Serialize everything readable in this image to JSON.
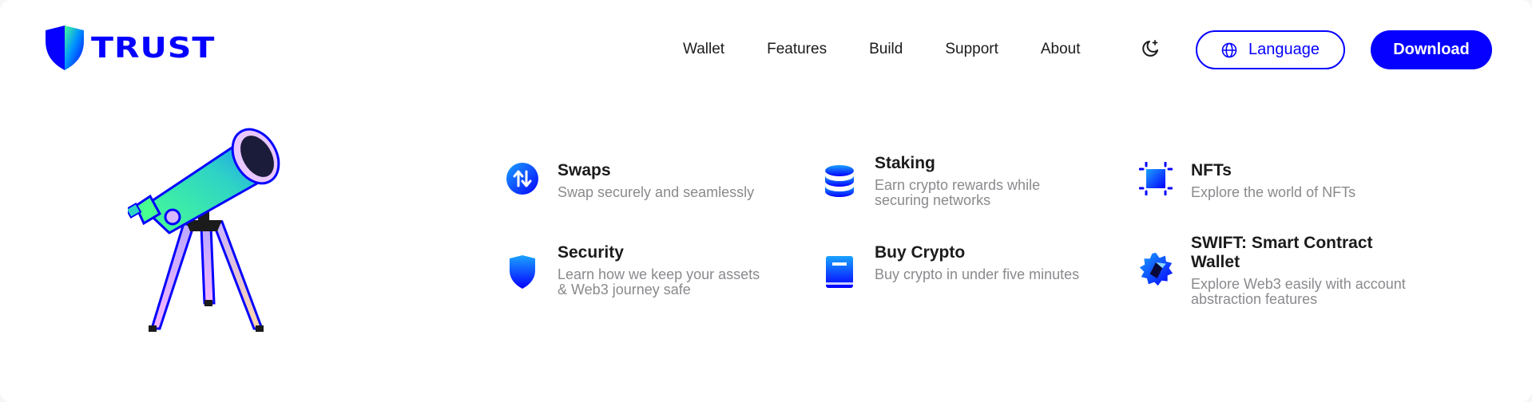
{
  "brand": {
    "name": "TRUST",
    "accent": "#0500ff"
  },
  "nav": {
    "items": [
      "Wallet",
      "Features",
      "Build",
      "Support",
      "About"
    ],
    "theme_toggle_icon": "moon-icon",
    "language_label": "Language",
    "download_label": "Download"
  },
  "features": [
    {
      "title": "Swaps",
      "description": "Swap securely and seamlessly",
      "icon": "swap-arrows-icon"
    },
    {
      "title": "Staking",
      "description": "Earn crypto rewards while securing networks",
      "icon": "coin-stack-icon"
    },
    {
      "title": "NFTs",
      "description": "Explore the world of NFTs",
      "icon": "nft-frame-icon"
    },
    {
      "title": "Security",
      "description": "Learn how we keep your assets & Web3 journey safe",
      "icon": "shield-icon"
    },
    {
      "title": "Buy Crypto",
      "description": "Buy crypto in under five minutes",
      "icon": "book-icon"
    },
    {
      "title": "SWIFT: Smart Contract Wallet",
      "description": "Explore Web3 easily with account abstraction features",
      "icon": "swift-gear-icon"
    }
  ]
}
